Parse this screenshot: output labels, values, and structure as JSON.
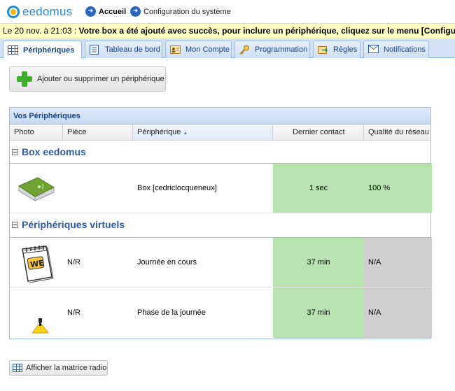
{
  "header": {
    "logo_text": "eedomus",
    "home_label": "Accueil",
    "config_label": "Configuration du système"
  },
  "message": {
    "date": "Le 20 nov. à 21:03 : ",
    "text": "Votre box a été ajouté avec succès, pour inclure un périphérique, cliquez sur le menu [Configuration]"
  },
  "tabs": [
    {
      "label": "Périphériques",
      "icon": "grid-icon",
      "active": true
    },
    {
      "label": "Tableau de bord",
      "icon": "dashboard-icon",
      "active": false
    },
    {
      "label": "Mon Compte",
      "icon": "user-icon",
      "active": false
    },
    {
      "label": "Programmation",
      "icon": "key-icon",
      "active": false
    },
    {
      "label": "Règles",
      "icon": "rules-icon",
      "active": false
    },
    {
      "label": "Notifications",
      "icon": "mail-icon",
      "active": false
    }
  ],
  "add_button_label": "Ajouter ou supprimer un périphérique",
  "panel": {
    "title": "Vos Périphériques",
    "columns": [
      "Photo",
      "Pièce",
      "Périphérique",
      "Dernier contact",
      "Qualité du réseau"
    ],
    "sorted_column": "Périphérique",
    "groups": [
      {
        "title": "Box eedomus",
        "rows": [
          {
            "photo": "box-device-icon",
            "room": "",
            "device": "Box [cedriclocqueneux]",
            "last_contact": "1 sec",
            "quality": "100 %"
          }
        ]
      },
      {
        "title": "Périphériques virtuels",
        "rows": [
          {
            "photo": "calendar-we-icon",
            "room": "N/R",
            "device": "Journée en cours",
            "last_contact": "37 min",
            "quality": "N/A"
          },
          {
            "photo": "lamp-icon",
            "room": "N/R",
            "device": "Phase de la journée",
            "last_contact": "37 min",
            "quality": "N/A"
          }
        ]
      }
    ]
  },
  "matrix_button_label": "Afficher la matrice radio",
  "colors": {
    "ok_green": "#b8e3b1",
    "na_grey": "#cfcfcf",
    "accent_blue": "#15428b",
    "message_yellow": "#ffffc4"
  }
}
